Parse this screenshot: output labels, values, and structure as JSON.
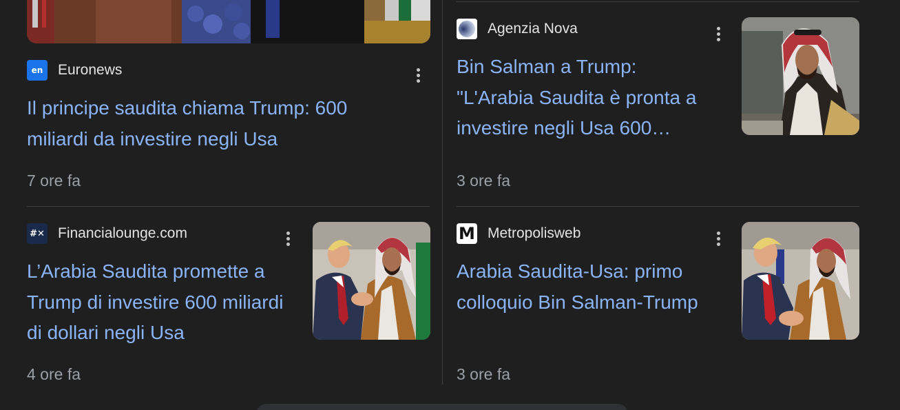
{
  "articles": [
    {
      "source": "Euronews",
      "favicon_text": "en",
      "title_line1": "Il principe saudita chiama Trump: 600",
      "title_line2": "miliardi da investire negli Usa",
      "title_line3": "",
      "time": "7 ore fa"
    },
    {
      "source": "Agenzia Nova",
      "favicon_text": "",
      "title_line1": "Bin Salman a Trump:",
      "title_line2": "\"L'Arabia Saudita è pronta a",
      "title_line3": "investire negli Usa 600…",
      "time": "3 ore fa"
    },
    {
      "source": "Financialounge.com",
      "favicon_text": "#✕",
      "title_line1": "L’Arabia Saudita promette a",
      "title_line2": "Trump di investire 600 miliardi",
      "title_line3": "di dollari negli Usa",
      "time": "4 ore fa"
    },
    {
      "source": "Metropolisweb",
      "favicon_text": "M",
      "title_line1": "Arabia Saudita-Usa: primo",
      "title_line2": "colloquio Bin Salman-Trump",
      "title_line3": "",
      "time": "3 ore fa"
    }
  ],
  "colors": {
    "background": "#1f1f1f",
    "headline": "#8ab4f8",
    "source_text": "#e3e3e3",
    "time_text": "#9aa0a6",
    "divider": "#3c4043",
    "euronews_blue": "#1a73e8"
  },
  "icons": {
    "more": "more-vert-icon"
  }
}
